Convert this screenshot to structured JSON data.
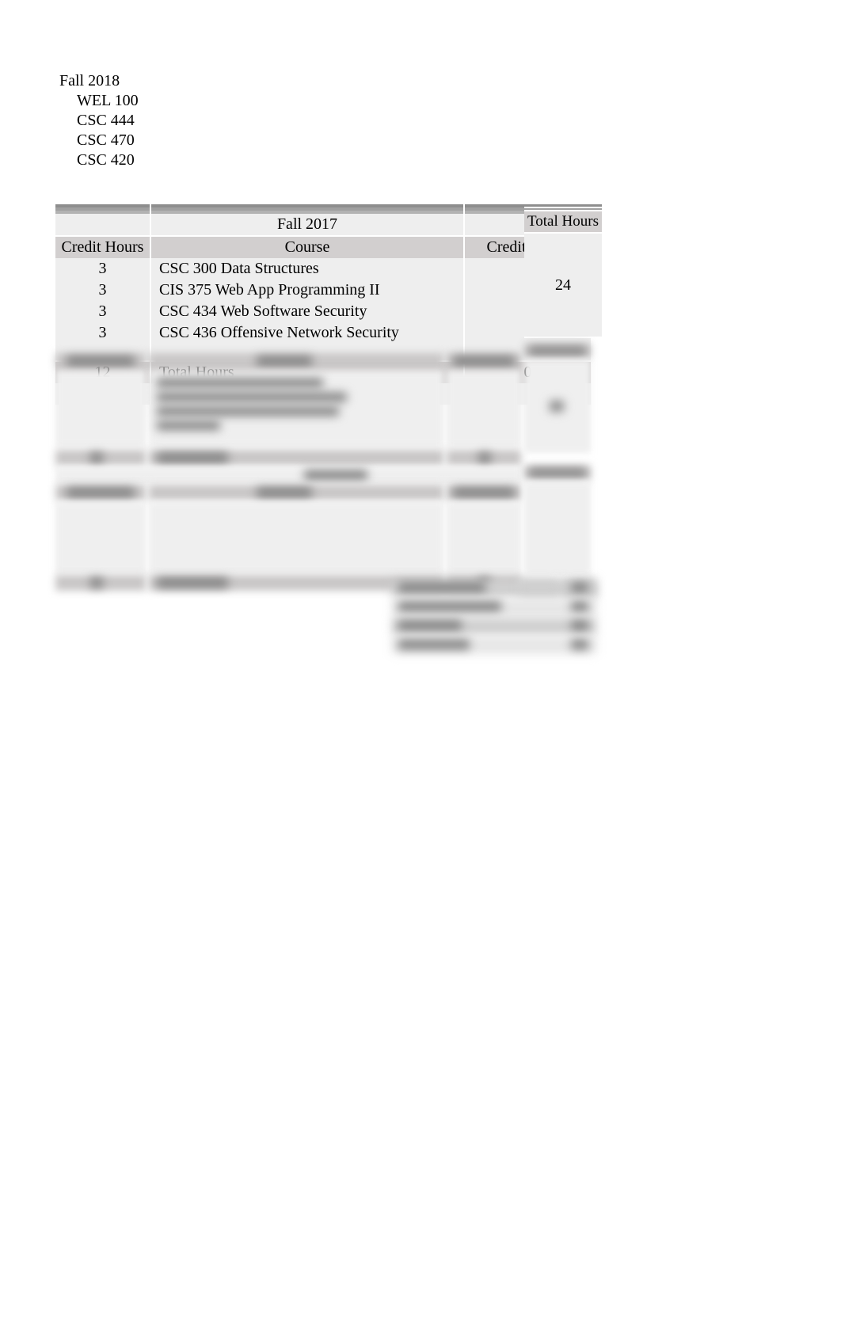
{
  "top": {
    "semester": "Fall 2018",
    "courses": [
      "WEL 100",
      "CSC 444",
      "CSC 470",
      "CSC 420"
    ]
  },
  "labels": {
    "credit_hours": "Credit Hours",
    "course": "Course",
    "total_hours": "Total Hours",
    "total_hours_row": "Total Hours"
  },
  "semesters": [
    {
      "title": "Fall 2017",
      "rows": [
        {
          "ch": "3",
          "course": "CSC 300 Data Structures"
        },
        {
          "ch": "3",
          "course": "CIS 375 Web App Programming II"
        },
        {
          "ch": "3",
          "course": "CSC 434 Web Software Security"
        },
        {
          "ch": "3",
          "course": "CSC 436 Offensive Network Security"
        }
      ],
      "blankRows": 1,
      "total_left": "12",
      "total_right": "0",
      "total_box": "24"
    },
    {
      "title": "Fall 2018"
    }
  ]
}
